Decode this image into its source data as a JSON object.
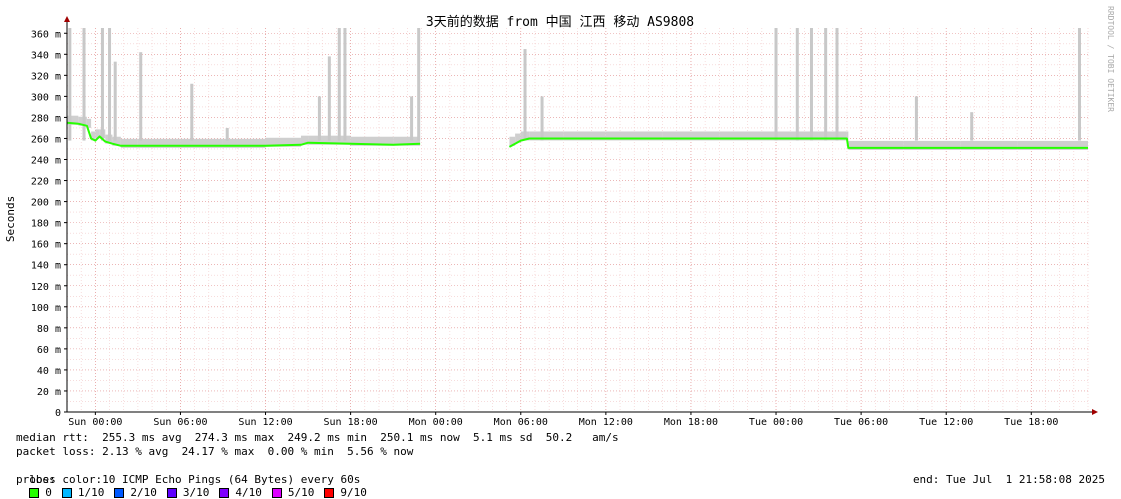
{
  "chart_data": {
    "type": "line",
    "title": "3天前的数据 from 中国 江西 移动 AS9808",
    "ylabel": "Seconds",
    "watermark": "RRDTOOL / TOBI OETIKER",
    "ylim": [
      0,
      365
    ],
    "y_unit": "ms",
    "y_ticks": [
      0,
      20,
      40,
      60,
      80,
      100,
      120,
      140,
      160,
      180,
      200,
      220,
      240,
      260,
      280,
      300,
      320,
      340,
      360
    ],
    "y_tick_labels": [
      "0",
      "20 m",
      "40 m",
      "60 m",
      "80 m",
      "100 m",
      "120 m",
      "140 m",
      "160 m",
      "180 m",
      "200 m",
      "220 m",
      "240 m",
      "260 m",
      "280 m",
      "300 m",
      "320 m",
      "340 m",
      "360 m"
    ],
    "x_ticks": [
      "Sun 00:00",
      "Sun 06:00",
      "Sun 12:00",
      "Sun 18:00",
      "Mon 00:00",
      "Mon 06:00",
      "Mon 12:00",
      "Mon 18:00",
      "Tue 00:00",
      "Tue 06:00",
      "Tue 12:00",
      "Tue 18:00"
    ],
    "x_range_hours": [
      -2,
      70
    ],
    "grid": true,
    "series": [
      {
        "segment": 1,
        "color_loss": "0/10",
        "points": [
          [
            -2.0,
            275
          ],
          [
            -1.2,
            274
          ],
          [
            -0.6,
            272
          ],
          [
            -0.3,
            260
          ],
          [
            0.0,
            258
          ],
          [
            0.3,
            262
          ],
          [
            0.7,
            257
          ],
          [
            1.2,
            255
          ],
          [
            1.8,
            253
          ],
          [
            3,
            253
          ],
          [
            6,
            253
          ],
          [
            9,
            253
          ],
          [
            12,
            253
          ],
          [
            14.5,
            254
          ],
          [
            15,
            256
          ],
          [
            18,
            255
          ],
          [
            21,
            254
          ],
          [
            22.9,
            255
          ]
        ]
      },
      {
        "segment": 2,
        "color_loss": "0/10",
        "points": [
          [
            29.2,
            252
          ],
          [
            29.6,
            255
          ],
          [
            30.0,
            258
          ],
          [
            30.6,
            260
          ],
          [
            33,
            260
          ],
          [
            36,
            260
          ],
          [
            40,
            260
          ],
          [
            44,
            260
          ],
          [
            48,
            260
          ],
          [
            53,
            260
          ],
          [
            53.1,
            251
          ],
          [
            57,
            251
          ],
          [
            61,
            251
          ],
          [
            65,
            251
          ],
          [
            70,
            251
          ]
        ]
      }
    ],
    "smoke_spikes": [
      {
        "x": -1.8,
        "max": 365
      },
      {
        "x": -0.8,
        "max": 365
      },
      {
        "x": 0.5,
        "max": 365
      },
      {
        "x": 1.0,
        "max": 365
      },
      {
        "x": 1.4,
        "max": 333
      },
      {
        "x": 3.2,
        "max": 342
      },
      {
        "x": 6.8,
        "max": 312
      },
      {
        "x": 9.3,
        "max": 270
      },
      {
        "x": 15.8,
        "max": 300
      },
      {
        "x": 16.5,
        "max": 338
      },
      {
        "x": 17.2,
        "max": 365
      },
      {
        "x": 17.6,
        "max": 365
      },
      {
        "x": 22.3,
        "max": 300
      },
      {
        "x": 22.8,
        "max": 365
      },
      {
        "x": 30.3,
        "max": 345
      },
      {
        "x": 31.5,
        "max": 300
      },
      {
        "x": 48.0,
        "max": 365
      },
      {
        "x": 49.5,
        "max": 365
      },
      {
        "x": 50.5,
        "max": 365
      },
      {
        "x": 51.5,
        "max": 365
      },
      {
        "x": 52.3,
        "max": 365
      },
      {
        "x": 57.9,
        "max": 300
      },
      {
        "x": 61.8,
        "max": 285
      },
      {
        "x": 69.4,
        "max": 365
      }
    ]
  },
  "stats": {
    "median_rtt": "median rtt:  255.3 ms avg  274.3 ms max  249.2 ms min  250.1 ms now  5.1 ms sd  50.2   am/s",
    "packet_loss": "packet loss: 2.13 % avg  24.17 % max  0.00 % min  5.56 % now",
    "loss_color_label": "loss color:",
    "probe": "probe:       10 ICMP Echo Pings (64 Bytes) every 60s",
    "end": "end: Tue Jul  1 21:58:08 2025"
  },
  "legend": [
    {
      "label": "0",
      "color": "#26ff00"
    },
    {
      "label": "1/10",
      "color": "#00b8ff"
    },
    {
      "label": "2/10",
      "color": "#0059ff"
    },
    {
      "label": "3/10",
      "color": "#5e00ff"
    },
    {
      "label": "4/10",
      "color": "#7e00ff"
    },
    {
      "label": "5/10",
      "color": "#dd00ff"
    },
    {
      "label": "9/10",
      "color": "#ff0000"
    }
  ]
}
